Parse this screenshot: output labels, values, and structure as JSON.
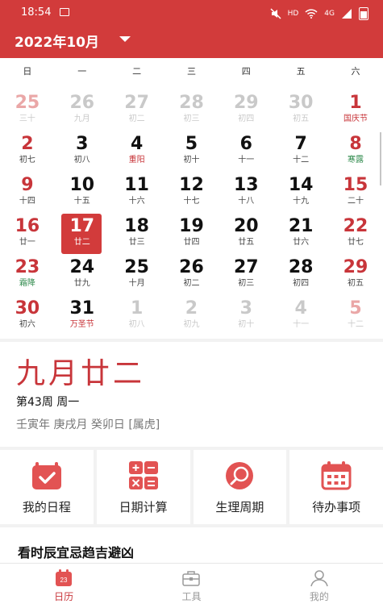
{
  "status": {
    "time": "18:54",
    "hd": "HD",
    "network": "4G"
  },
  "header": {
    "month_title": "2022年10月"
  },
  "weekdays": [
    "日",
    "一",
    "二",
    "三",
    "四",
    "五",
    "六"
  ],
  "weeks": [
    [
      {
        "n": "25",
        "s": "三十"
      },
      {
        "n": "26",
        "s": "九月"
      },
      {
        "n": "27",
        "s": "初二"
      },
      {
        "n": "28",
        "s": "初三"
      },
      {
        "n": "29",
        "s": "初四"
      },
      {
        "n": "30",
        "s": "初五"
      },
      {
        "n": "1",
        "s": "国庆节"
      }
    ],
    [
      {
        "n": "2",
        "s": "初七"
      },
      {
        "n": "3",
        "s": "初八"
      },
      {
        "n": "4",
        "s": "重阳"
      },
      {
        "n": "5",
        "s": "初十"
      },
      {
        "n": "6",
        "s": "十一"
      },
      {
        "n": "7",
        "s": "十二"
      },
      {
        "n": "8",
        "s": "寒露"
      }
    ],
    [
      {
        "n": "9",
        "s": "十四"
      },
      {
        "n": "10",
        "s": "十五"
      },
      {
        "n": "11",
        "s": "十六"
      },
      {
        "n": "12",
        "s": "十七"
      },
      {
        "n": "13",
        "s": "十八"
      },
      {
        "n": "14",
        "s": "十九"
      },
      {
        "n": "15",
        "s": "二十"
      }
    ],
    [
      {
        "n": "16",
        "s": "廿一"
      },
      {
        "n": "17",
        "s": "廿二"
      },
      {
        "n": "18",
        "s": "廿三"
      },
      {
        "n": "19",
        "s": "廿四"
      },
      {
        "n": "20",
        "s": "廿五"
      },
      {
        "n": "21",
        "s": "廿六"
      },
      {
        "n": "22",
        "s": "廿七"
      }
    ],
    [
      {
        "n": "23",
        "s": "霜降"
      },
      {
        "n": "24",
        "s": "廿九"
      },
      {
        "n": "25",
        "s": "十月"
      },
      {
        "n": "26",
        "s": "初二"
      },
      {
        "n": "27",
        "s": "初三"
      },
      {
        "n": "28",
        "s": "初四"
      },
      {
        "n": "29",
        "s": "初五"
      }
    ],
    [
      {
        "n": "30",
        "s": "初六"
      },
      {
        "n": "31",
        "s": "万圣节"
      },
      {
        "n": "1",
        "s": "初八"
      },
      {
        "n": "2",
        "s": "初九"
      },
      {
        "n": "3",
        "s": "初十"
      },
      {
        "n": "4",
        "s": "十一"
      },
      {
        "n": "5",
        "s": "十二"
      }
    ]
  ],
  "selected_day": "17",
  "detail": {
    "lunar_date": "九月廿二",
    "week_info": "第43周   周一",
    "ganzhi": "壬寅年 庚戌月 癸卯日 [属虎]"
  },
  "tools": [
    {
      "label": "我的日程",
      "icon": "calendar-check-icon"
    },
    {
      "label": "日期计算",
      "icon": "calculator-icon"
    },
    {
      "label": "生理周期",
      "icon": "cycle-icon"
    },
    {
      "label": "待办事项",
      "icon": "todo-calendar-icon"
    }
  ],
  "tip": {
    "title": "看时辰宜忌趋吉避凶"
  },
  "nav": [
    {
      "label": "日历",
      "icon_text": "23"
    },
    {
      "label": "工具"
    },
    {
      "label": "我的"
    }
  ],
  "colors": {
    "brand_red": "#d23b3b",
    "holiday_red": "#c8353a",
    "term_green": "#2f8a4c"
  }
}
